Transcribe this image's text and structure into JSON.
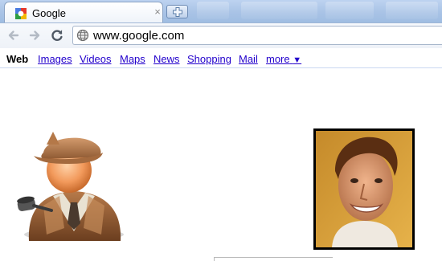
{
  "browser": {
    "tab": {
      "title": "Google",
      "close_glyph": "×",
      "favicon": "google-favicon-icon"
    },
    "new_tab_icon": "new-tab-icon",
    "toolbar": {
      "back_icon": "back-arrow-icon",
      "forward_icon": "forward-arrow-icon",
      "reload_icon": "reload-icon",
      "address_icon": "globe-icon",
      "address": "www.google.com"
    }
  },
  "google_nav": {
    "current": "Web",
    "links": [
      "Images",
      "Videos",
      "Maps",
      "News",
      "Shopping",
      "Mail"
    ],
    "more_label": "more",
    "more_arrow": "▼"
  },
  "content": {
    "left_image": "detective-avatar-icon",
    "right_image": "profile-photo"
  },
  "colors": {
    "link": "#2200cc",
    "tabstrip": "#a9c3e6",
    "photo_border": "#000000"
  }
}
